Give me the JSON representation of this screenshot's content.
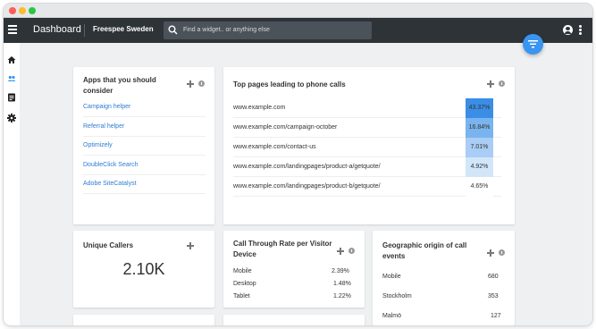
{
  "topbar": {
    "title": "Dashboard",
    "account": "Freespee Sweden",
    "search_placeholder": "Find a widget.. or anything else"
  },
  "sidebar": {
    "items": [
      {
        "icon": "home-icon"
      },
      {
        "icon": "people-icon"
      },
      {
        "icon": "document-icon"
      },
      {
        "icon": "gear-icon"
      }
    ]
  },
  "apps_card": {
    "title": "Apps that you should consider",
    "links": [
      "Campaign helper",
      "Referral helper",
      "Optimizely",
      "DoubleClick Search",
      "Adobe SiteCatalyst"
    ]
  },
  "pages_card": {
    "title": "Top pages leading to phone calls",
    "rows": [
      {
        "url": "www.example.com",
        "percent": "43.37%",
        "color": "#3a8ee6"
      },
      {
        "url": "www.example.com/campaign-october",
        "percent": "16.84%",
        "color": "#79b4ee"
      },
      {
        "url": "www.example.com/contact-us",
        "percent": "7.01%",
        "color": "#a9cdf4"
      },
      {
        "url": "www.example.com/landingpages/product-a/getquote/",
        "percent": "4.92%",
        "color": "#d2e6fa"
      },
      {
        "url": "www.example.com/landingpages/product-b/getquote/",
        "percent": "4.65%",
        "color": "#ffffff"
      }
    ]
  },
  "callers_card": {
    "title": "Unique Callers",
    "value": "2.10K"
  },
  "rate_card": {
    "title": "Call Through Rate per Visitor Device",
    "rows": [
      {
        "label": "Mobile",
        "value": "2.39%"
      },
      {
        "label": "Desktop",
        "value": "1.48%"
      },
      {
        "label": "Tablet",
        "value": "1.22%"
      }
    ]
  },
  "geo_card": {
    "title": "Geographic origin of call events",
    "rows": [
      {
        "label": "Mobile",
        "value": "680"
      },
      {
        "label": "Stockholm",
        "value": "353"
      },
      {
        "label": "Malmö",
        "value": "127"
      }
    ]
  },
  "colors": {
    "topbar": "#2e3338",
    "accent": "#3a95f0",
    "link": "#2b7cd3"
  }
}
